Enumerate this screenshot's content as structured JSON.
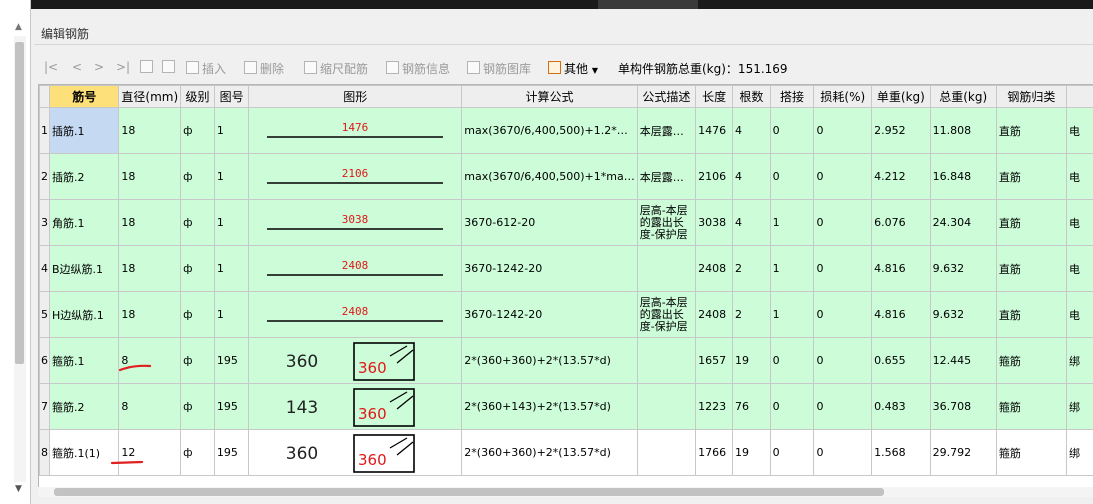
{
  "panel": {
    "title": "编辑钢筋"
  },
  "toolbar": {
    "nav": [
      "|<",
      "<",
      ">",
      ">|"
    ],
    "insert": "插入",
    "delete": "删除",
    "scale": "缩尺配筋",
    "info": "钢筋信息",
    "library": "钢筋图库",
    "other": "其他",
    "total_label": "单构件钢筋总重(kg)：151.169"
  },
  "columns": [
    "筋号",
    "直径(mm)",
    "级别",
    "图号",
    "图形",
    "计算公式",
    "公式描述",
    "长度",
    "根数",
    "搭接",
    "损耗(%)",
    "单重(kg)",
    "总重(kg)",
    "钢筋归类",
    ""
  ],
  "rows": [
    {
      "rn": "1",
      "name": "插筋.1",
      "dia": "18",
      "grade": "ф",
      "fig_no": "1",
      "shape": "line",
      "shape_value": "1476",
      "formula": "max(3670/6,400,500)+1.2*…",
      "desc": "本层露…",
      "length": "1476",
      "count": "4",
      "lap": "0",
      "loss": "0",
      "unit": "2.952",
      "total": "11.808",
      "cat": "直筋",
      "extra": "电"
    },
    {
      "rn": "2",
      "name": "插筋.2",
      "dia": "18",
      "grade": "ф",
      "fig_no": "1",
      "shape": "line",
      "shape_value": "2106",
      "formula": "max(3670/6,400,500)+1*ma…",
      "desc": "本层露…",
      "length": "2106",
      "count": "4",
      "lap": "0",
      "loss": "0",
      "unit": "4.212",
      "total": "16.848",
      "cat": "直筋",
      "extra": "电"
    },
    {
      "rn": "3",
      "name": "角筋.1",
      "dia": "18",
      "grade": "ф",
      "fig_no": "1",
      "shape": "line",
      "shape_value": "3038",
      "formula": "3670-612-20",
      "desc": "层高-本层的露出长度-保护层",
      "length": "3038",
      "count": "4",
      "lap": "1",
      "loss": "0",
      "unit": "6.076",
      "total": "24.304",
      "cat": "直筋",
      "extra": "电"
    },
    {
      "rn": "4",
      "name": "B边纵筋.1",
      "dia": "18",
      "grade": "ф",
      "fig_no": "1",
      "shape": "line",
      "shape_value": "2408",
      "formula": "3670-1242-20",
      "desc": "",
      "length": "2408",
      "count": "2",
      "lap": "1",
      "loss": "0",
      "unit": "4.816",
      "total": "9.632",
      "cat": "直筋",
      "extra": "电"
    },
    {
      "rn": "5",
      "name": "H边纵筋.1",
      "dia": "18",
      "grade": "ф",
      "fig_no": "1",
      "shape": "line",
      "shape_value": "2408",
      "formula": "3670-1242-20",
      "desc": "层高-本层的露出长度-保护层",
      "length": "2408",
      "count": "2",
      "lap": "1",
      "loss": "0",
      "unit": "4.816",
      "total": "9.632",
      "cat": "直筋",
      "extra": "电"
    },
    {
      "rn": "6",
      "name": "箍筋.1",
      "dia": "8",
      "grade": "ф",
      "fig_no": "195",
      "shape": "stirrup",
      "shape_left": "360",
      "shape_value": "360",
      "formula": "2*(360+360)+2*(13.57*d)",
      "desc": "",
      "length": "1657",
      "count": "19",
      "lap": "0",
      "loss": "0",
      "unit": "0.655",
      "total": "12.445",
      "cat": "箍筋",
      "extra": "绑"
    },
    {
      "rn": "7",
      "name": "箍筋.2",
      "dia": "8",
      "grade": "ф",
      "fig_no": "195",
      "shape": "stirrup",
      "shape_left": "143",
      "shape_value": "360",
      "formula": "2*(360+143)+2*(13.57*d)",
      "desc": "",
      "length": "1223",
      "count": "76",
      "lap": "0",
      "loss": "0",
      "unit": "0.483",
      "total": "36.708",
      "cat": "箍筋",
      "extra": "绑"
    },
    {
      "rn": "8",
      "name": "箍筋.1(1)",
      "dia": "12",
      "grade": "ф",
      "fig_no": "195",
      "shape": "stirrup",
      "shape_left": "360",
      "shape_value": "360",
      "formula": "2*(360+360)+2*(13.57*d)",
      "desc": "",
      "length": "1766",
      "count": "19",
      "lap": "0",
      "loss": "0",
      "unit": "1.568",
      "total": "29.792",
      "cat": "箍筋",
      "extra": "绑"
    }
  ],
  "colors": {
    "row_green": "#ccfcd8",
    "header_key": "#fde07a",
    "selected": "#c5d9f3",
    "shape_text": "#e01818",
    "annotation_red": "#e02020"
  }
}
